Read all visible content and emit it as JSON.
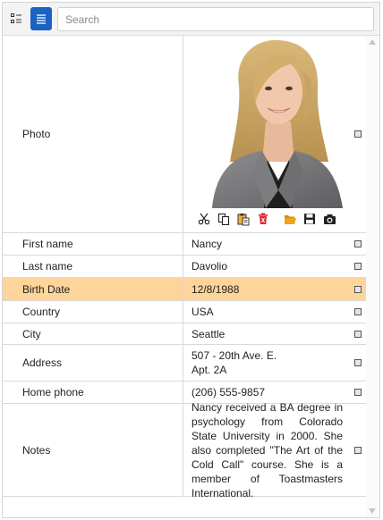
{
  "toolbar": {
    "categorized_icon": "categorized-view-icon",
    "alphabetical_icon": "alphabetical-view-icon",
    "search_placeholder": "Search"
  },
  "photo_row": {
    "label": "Photo",
    "tools": [
      "cut-icon",
      "copy-icon",
      "paste-icon",
      "delete-icon",
      "open-folder-icon",
      "save-icon",
      "camera-icon"
    ]
  },
  "properties": [
    {
      "label": "First name",
      "value": "Nancy"
    },
    {
      "label": "Last name",
      "value": "Davolio"
    },
    {
      "label": "Birth Date",
      "value": "12/8/1988"
    },
    {
      "label": "Country",
      "value": "USA"
    },
    {
      "label": "City",
      "value": "Seattle"
    },
    {
      "label": "Address",
      "value_line1": "507 - 20th Ave. E.",
      "value_line2": "Apt. 2A"
    },
    {
      "label": "Home phone",
      "value": "(206) 555-9857"
    },
    {
      "label": "Notes",
      "value": "Nancy received a BA degree in psychology from Colorado State University in 2000. She also completed \"The Art of the Cold Call\" course. She is a member of Toastmasters International."
    }
  ],
  "colors": {
    "accent": "#1a62c4",
    "highlight_row": "#fdd49a",
    "delete_icon": "#e0282e",
    "folder_icon": "#f0a21c"
  }
}
